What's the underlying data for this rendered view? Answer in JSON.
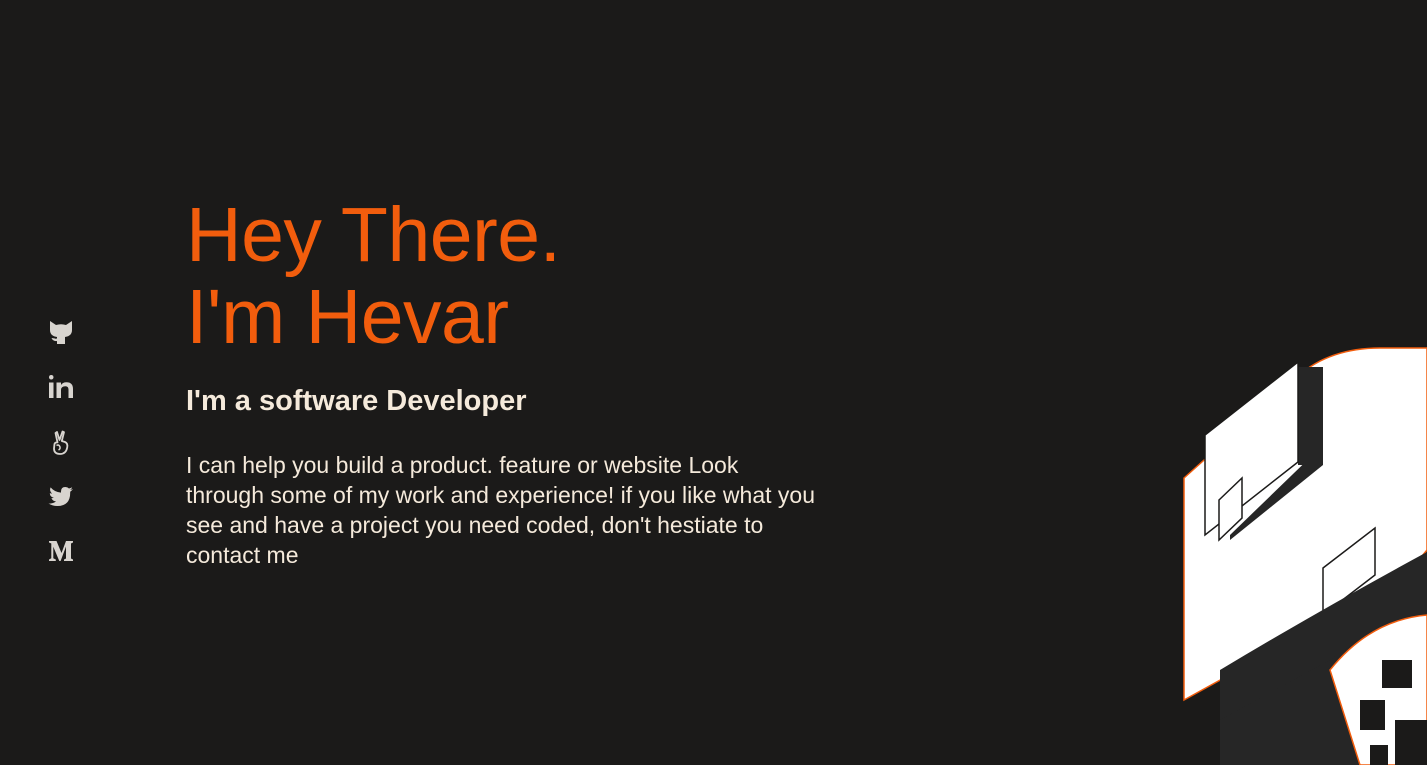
{
  "hero": {
    "line1": "Hey There.",
    "line2": "I'm Hevar",
    "subtitle": "I'm a software Developer",
    "description": "I can help you build a product. feature or website Look through some of my work and experience! if you like what you see and have a project you need coded, don't hestiate to contact me"
  },
  "social": [
    {
      "name": "github",
      "icon": "github-icon"
    },
    {
      "name": "linkedin",
      "icon": "linkedin-icon"
    },
    {
      "name": "angellist",
      "icon": "angellist-icon"
    },
    {
      "name": "twitter",
      "icon": "twitter-icon"
    },
    {
      "name": "medium",
      "icon": "medium-icon"
    }
  ],
  "colors": {
    "background": "#1b1a19",
    "accent": "#f25d0d",
    "text": "#f5eadb",
    "icon": "#d8d4cf"
  }
}
